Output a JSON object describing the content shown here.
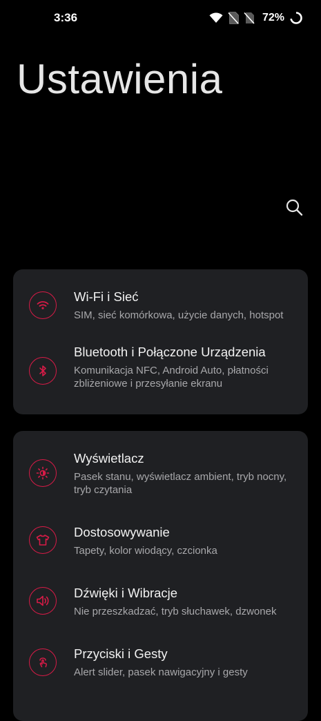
{
  "status_bar": {
    "time": "3:36",
    "battery": "72%",
    "icons": [
      "wifi-icon",
      "no-sim-icon",
      "no-sim-icon",
      "battery-ring-icon"
    ]
  },
  "header": {
    "title": "Ustawienia",
    "search_icon": "search-icon"
  },
  "accent_color": "#d81b47",
  "groups": [
    {
      "items": [
        {
          "title": "Wi-Fi i Sieć",
          "subtitle": "SIM, sieć komórkowa, użycie danych, hotspot",
          "icon": "wifi-icon"
        },
        {
          "title": "Bluetooth i Połączone Urządzenia",
          "subtitle": "Komunikacja NFC, Android Auto, płatności zbliżeniowe i przesyłanie ekranu",
          "icon": "bluetooth-icon"
        }
      ]
    },
    {
      "items": [
        {
          "title": "Wyświetlacz",
          "subtitle": "Pasek stanu, wyświetlacz ambient, tryb nocny, tryb czytania",
          "icon": "brightness-icon"
        },
        {
          "title": "Dostosowywanie",
          "subtitle": "Tapety, kolor wiodący, czcionka",
          "icon": "tshirt-icon"
        },
        {
          "title": "Dźwięki i Wibracje",
          "subtitle": "Nie przeszkadzać, tryb słuchawek, dzwonek",
          "icon": "speaker-icon"
        },
        {
          "title": "Przyciski i Gesty",
          "subtitle": "Alert slider, pasek nawigacyjny i gesty",
          "icon": "gesture-icon"
        }
      ]
    }
  ]
}
